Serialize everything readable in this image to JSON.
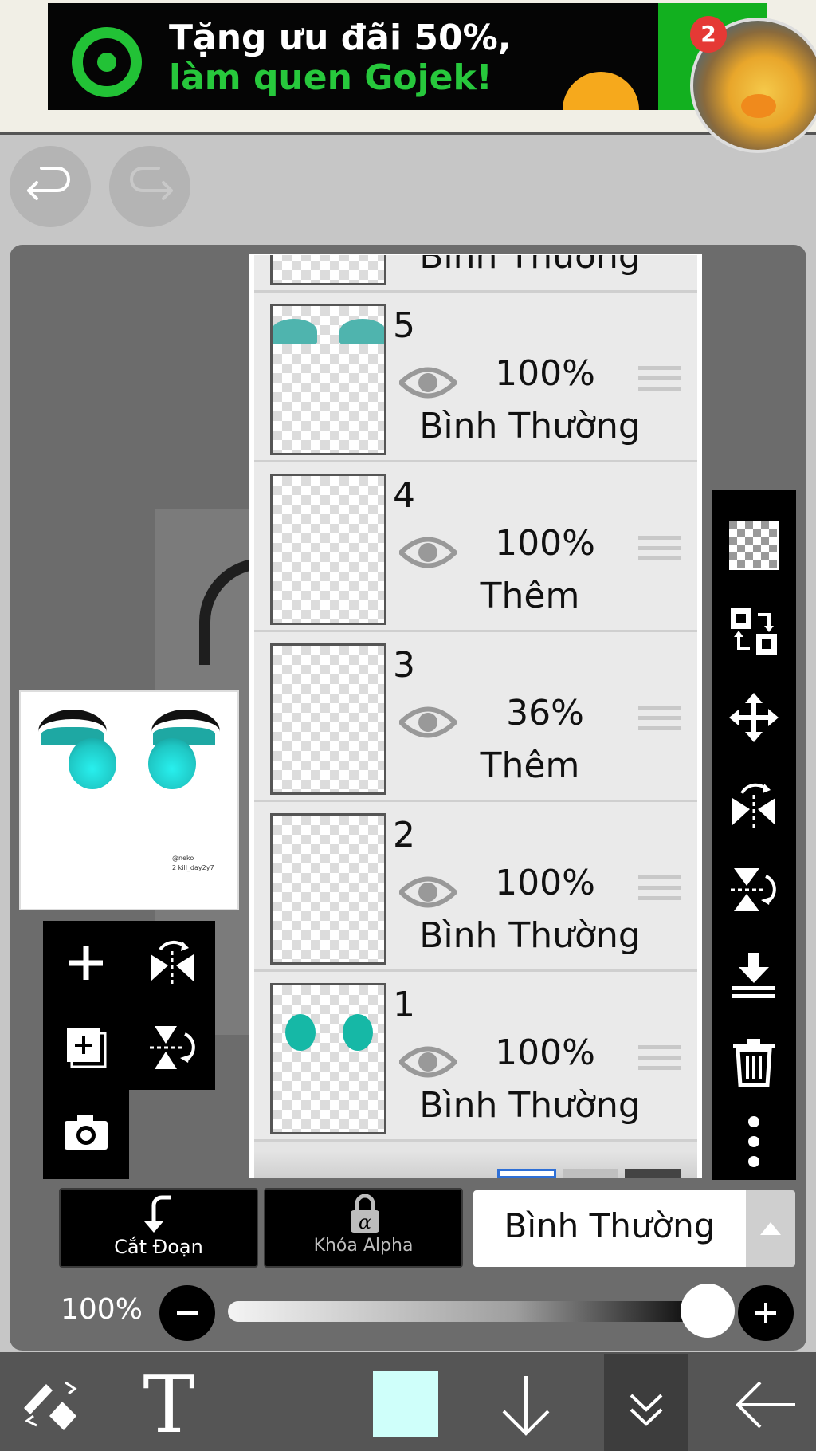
{
  "ad": {
    "line1": "Tặng ưu đãi 50%,",
    "line2": "làm quen Gojek!",
    "notification_count": "2"
  },
  "thumbnail": {
    "watermark_line1": "@neko",
    "watermark_line2": "2 kill_day2y7"
  },
  "layers": [
    {
      "number": "",
      "opacity": "",
      "mode": "Bình Thường"
    },
    {
      "number": "5",
      "opacity": "100%",
      "mode": "Bình Thường"
    },
    {
      "number": "4",
      "opacity": "100%",
      "mode": "Thêm"
    },
    {
      "number": "3",
      "opacity": "36%",
      "mode": "Thêm"
    },
    {
      "number": "2",
      "opacity": "100%",
      "mode": "Bình Thường"
    },
    {
      "number": "1",
      "opacity": "100%",
      "mode": "Bình Thường"
    }
  ],
  "controls": {
    "clipping_label": "Cắt Đoạn",
    "alpha_lock_label": "Khóa Alpha",
    "blend_mode": "Bình Thường",
    "opacity_label": "100%",
    "opacity_value": 1.0
  },
  "colors": {
    "current_color": "#cffffa",
    "accent_green": "#27c83c"
  },
  "icons": {
    "undo": "undo-icon",
    "redo": "redo-icon",
    "add_layer": "plus-icon",
    "flip_h": "flip-horizontal-icon",
    "add_copy": "add-copy-icon",
    "flip_v": "flip-vertical-icon",
    "camera": "camera-icon",
    "transparency": "checkerboard-icon",
    "select_swap": "select-swap-icon",
    "move": "move-icon",
    "merge_down": "merge-down-icon",
    "delete": "trash-icon",
    "more": "more-vertical-icon",
    "brush_eraser": "brush-eraser-icon",
    "text": "text-icon",
    "down": "arrow-down-icon",
    "collapse": "double-chevron-down-icon",
    "back": "arrow-left-icon"
  }
}
